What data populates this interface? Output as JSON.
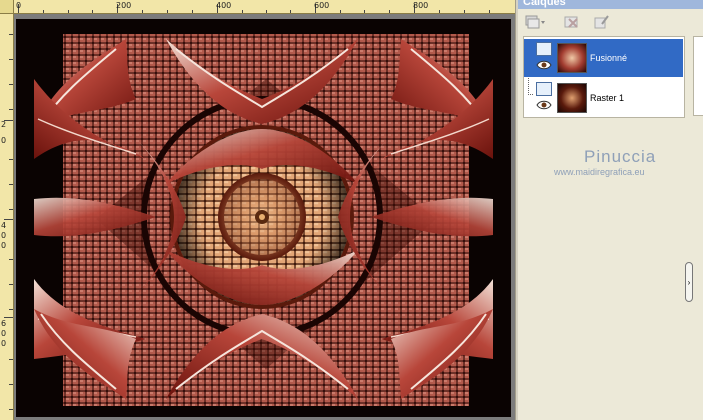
{
  "ruler": {
    "top_labels": [
      "0",
      "200",
      "400",
      "600",
      "800"
    ],
    "left_labels": [
      "2",
      "0",
      "4",
      "0",
      "0",
      "6",
      "0",
      "0"
    ]
  },
  "canvas": {
    "artwork_description_colors": {
      "primary": "#a23c30",
      "dark": "#2a0805",
      "light": "#f0c9a6"
    }
  },
  "palette": {
    "title": "Calques",
    "toolbar": {
      "new_layer_icon": "new-layer-icon",
      "delete_icon": "delete-layer-icon",
      "properties_icon": "layer-properties-icon"
    },
    "layers": [
      {
        "name": "Fusionné",
        "selected": true
      },
      {
        "name": "Raster 1",
        "selected": false
      }
    ],
    "watermark": {
      "line1": "Pinuccia",
      "line2": "www.maidiregrafica.eu"
    },
    "collapse_handle": "›"
  }
}
